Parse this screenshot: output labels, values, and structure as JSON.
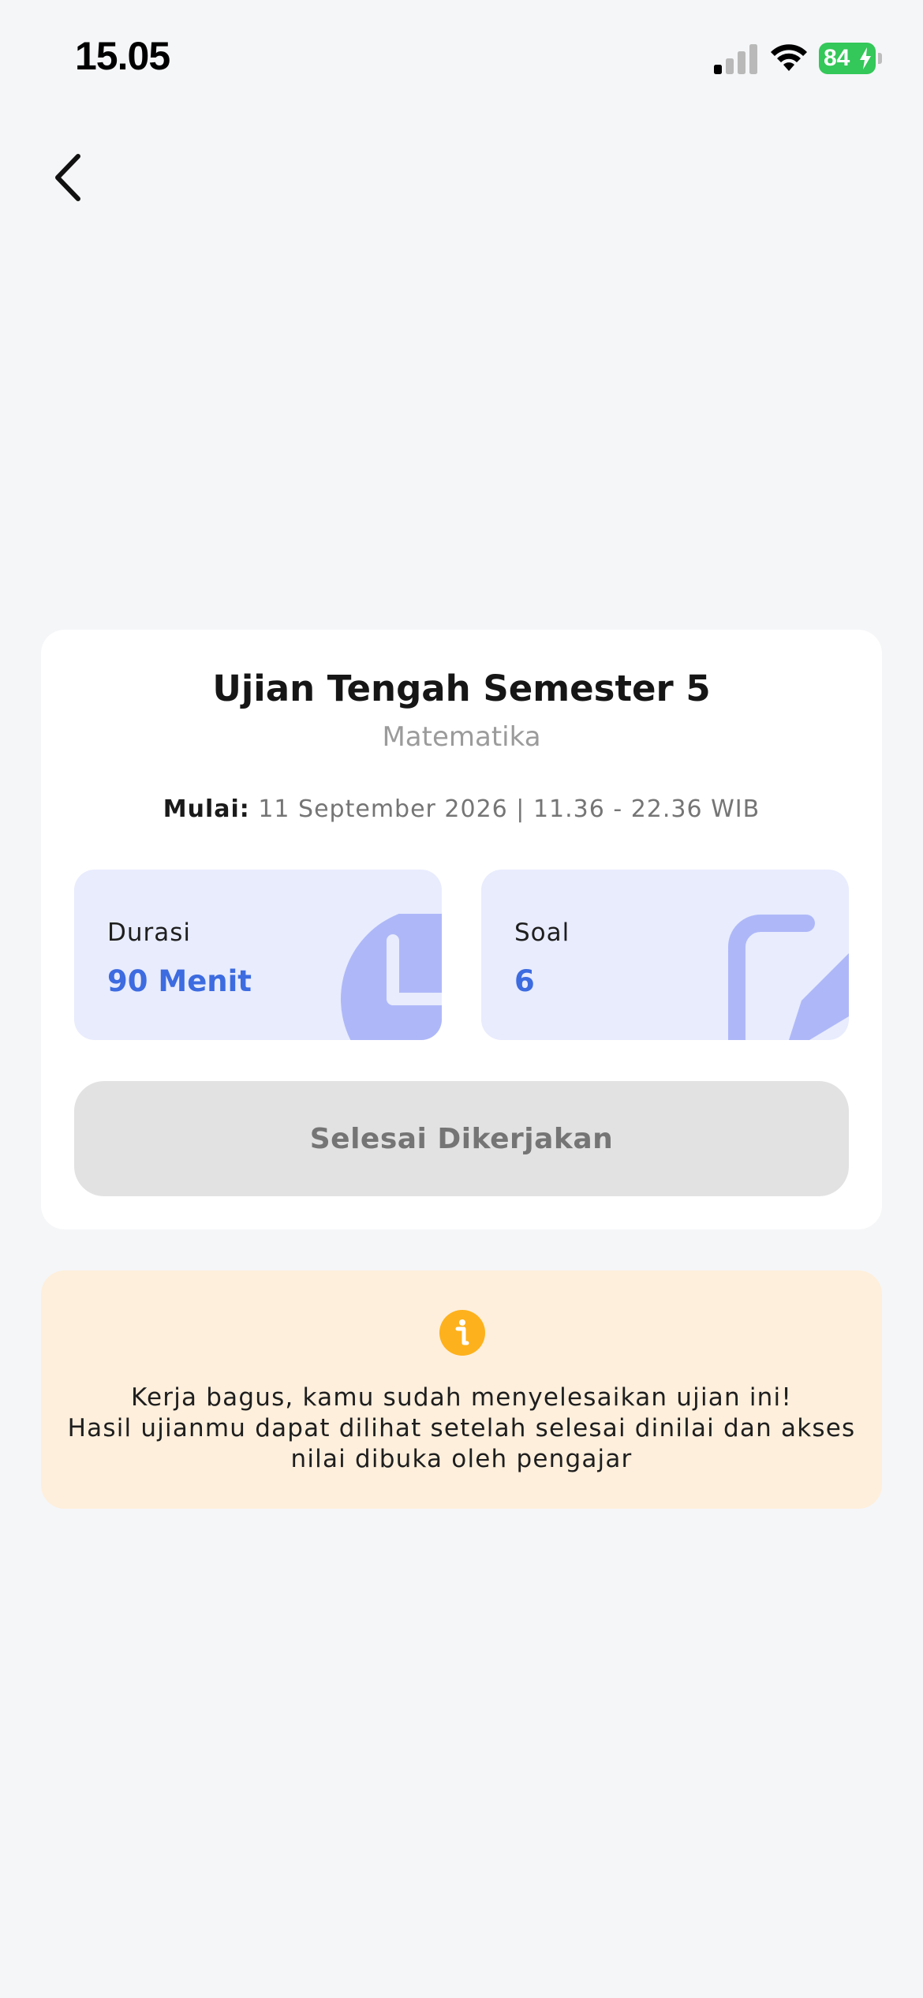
{
  "status_bar": {
    "time": "15.05",
    "battery_level": "84"
  },
  "exam": {
    "title": "Ujian Tengah Semester 5",
    "subject": "Matematika",
    "schedule_label": "Mulai:",
    "schedule_value": "11 September 2026 | 11.36 - 22.36 WIB",
    "duration_label": "Durasi",
    "duration_value": "90 Menit",
    "questions_label": "Soal",
    "questions_value": "6",
    "action_label": "Selesai Dikerjakan"
  },
  "notice": {
    "line1": "Kerja bagus, kamu sudah menyelesaikan ujian ini!",
    "line2": "Hasil ujianmu dapat dilihat setelah selesai dinilai dan akses",
    "line3": "nilai dibuka oleh pengajar"
  },
  "colors": {
    "background": "#F5F6F8",
    "card": "#FFFFFF",
    "tile": "#E8ECFD",
    "tile_art": "#AEB8F8",
    "accent": "#3D6BE0",
    "disabled_button": "#E2E2E2",
    "notice_bg": "#FEEFDC",
    "info_icon": "#FDB11C",
    "battery": "#34C759"
  },
  "icons": {
    "back": "chevron-left-icon",
    "duration": "clock-icon",
    "questions": "pencil-square-icon",
    "notice": "info-icon"
  }
}
